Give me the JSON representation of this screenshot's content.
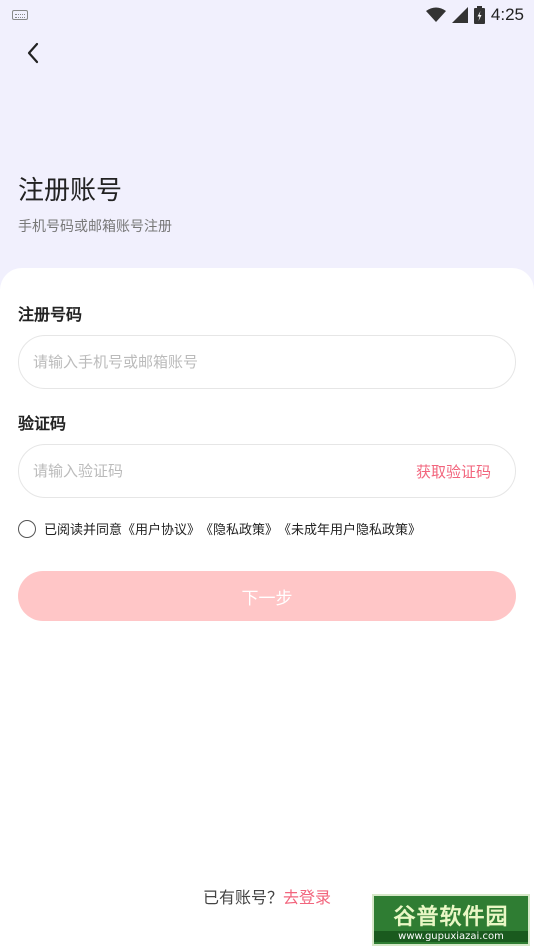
{
  "status_bar": {
    "time": "4:25",
    "icons": [
      "keyboard-icon",
      "wifi-icon",
      "signal-icon",
      "battery-icon"
    ]
  },
  "header": {
    "title": "注册账号",
    "subtitle": "手机号码或邮箱账号注册"
  },
  "form": {
    "phone_label": "注册号码",
    "phone_placeholder": "请输入手机号或邮箱账号",
    "code_label": "验证码",
    "code_placeholder": "请输入验证码",
    "get_code": "获取验证码",
    "agreement_prefix": "已阅读并同意",
    "agreement_user": "《用户协议》",
    "agreement_privacy": "《隐私政策》",
    "agreement_minor": "《未成年用户隐私政策》",
    "next_button": "下一步"
  },
  "footer": {
    "has_account": "已有账号？",
    "login_link": "去登录"
  },
  "watermark": {
    "title": "谷普软件园",
    "url": "www.gupuxiazai.com"
  },
  "colors": {
    "accent": "#f2657d",
    "button_disabled": "#ffc6c7",
    "header_bg": "#f1f0fd"
  }
}
